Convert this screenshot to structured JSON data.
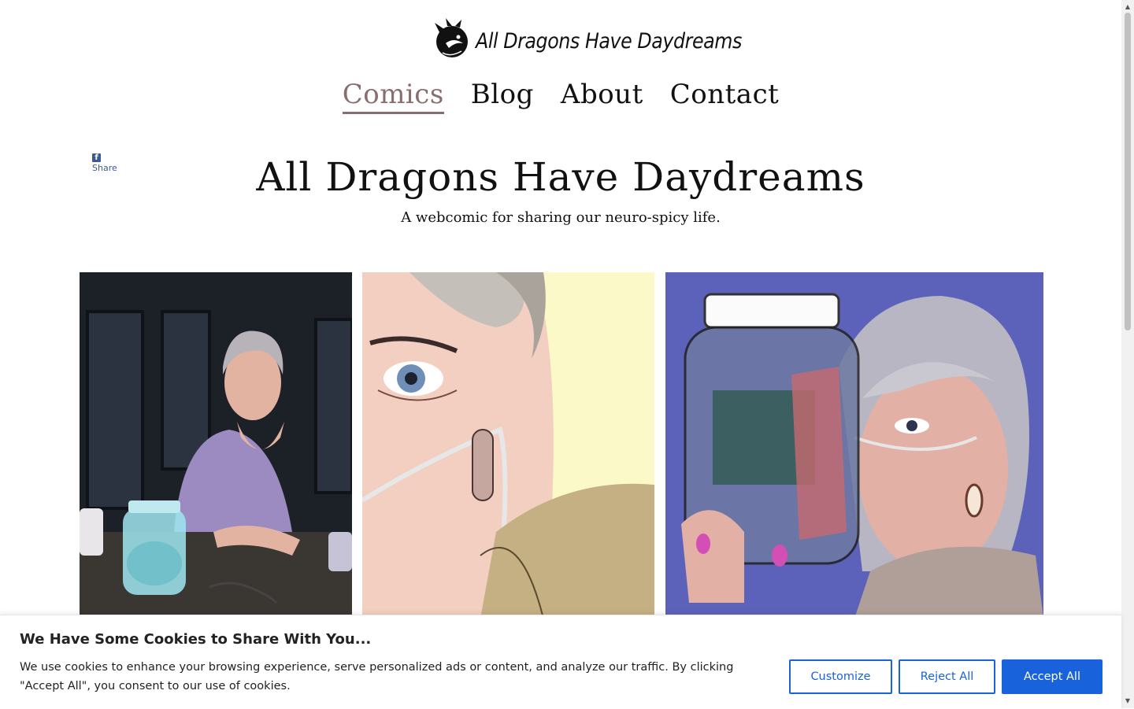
{
  "header": {
    "logo_text": "All Dragons Have Daydreams",
    "logo_icon": "dragon-icon"
  },
  "nav": {
    "items": [
      {
        "label": "Comics",
        "active": true
      },
      {
        "label": "Blog"
      },
      {
        "label": "About"
      },
      {
        "label": "Contact"
      }
    ]
  },
  "share": {
    "label": "Share",
    "icon": "facebook-icon"
  },
  "hero": {
    "title": "All Dragons Have Daydreams",
    "subtitle": "A webcomic for sharing our neuro-spicy life."
  },
  "gallery": {
    "images": [
      {
        "name": "comic-thumbnail-woman-at-table-with-glowing-jar"
      },
      {
        "name": "comic-thumbnail-woman-eye-closeup"
      },
      {
        "name": "comic-thumbnail-woman-holding-jar"
      }
    ]
  },
  "cookie_banner": {
    "title": "We Have Some Cookies to Share With You...",
    "text": "We use cookies to enhance your browsing experience, serve personalized ads or content, and analyze our traffic. By clicking \"Accept All\", you consent to our use of cookies.",
    "customize_label": "Customize",
    "reject_label": "Reject All",
    "accept_label": "Accept All"
  },
  "colors": {
    "nav_active": "#8a6d70",
    "facebook": "#3b5998",
    "cookie_primary": "#1863dc"
  }
}
